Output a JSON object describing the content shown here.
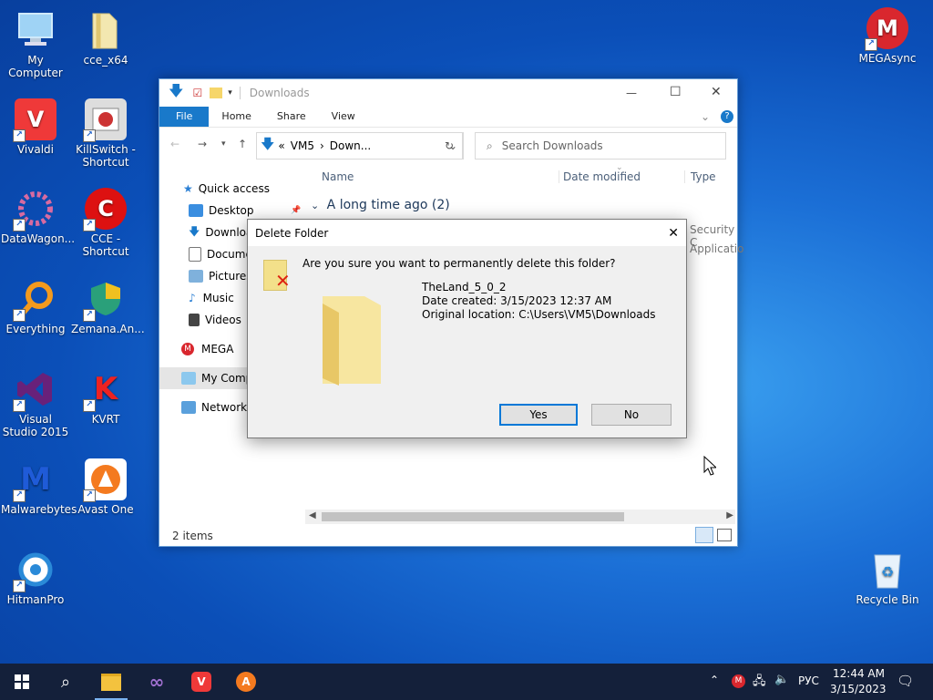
{
  "desktop": {
    "icons_left": [
      {
        "label": "My Computer",
        "icon": "computer-icon"
      },
      {
        "label": "cce_x64",
        "icon": "folder-icon"
      },
      {
        "label": "Vivaldi",
        "icon": "vivaldi-icon"
      },
      {
        "label": "KillSwitch - Shortcut",
        "icon": "killswitch-icon"
      },
      {
        "label": "DataWagon...",
        "icon": "datawagon-icon"
      },
      {
        "label": "CCE - Shortcut",
        "icon": "cce-icon"
      },
      {
        "label": "Everything",
        "icon": "everything-icon"
      },
      {
        "label": "Zemana.An...",
        "icon": "zemana-icon"
      },
      {
        "label": "Visual Studio 2015",
        "icon": "visual-studio-icon"
      },
      {
        "label": "KVRT",
        "icon": "kvrt-icon"
      },
      {
        "label": "Malwarebytes",
        "icon": "malwarebytes-icon"
      },
      {
        "label": "Avast One",
        "icon": "avast-icon"
      },
      {
        "label": "HitmanPro",
        "icon": "hitmanpro-icon"
      }
    ],
    "icons_right": [
      {
        "label": "MEGAsync",
        "icon": "mega-icon"
      },
      {
        "label": "Recycle Bin",
        "icon": "recycle-bin-icon"
      }
    ]
  },
  "explorer": {
    "title": "Downloads",
    "ribbon_tabs": [
      "File",
      "Home",
      "Share",
      "View"
    ],
    "address": {
      "prefix": "«",
      "part1": "VM5",
      "sep": "›",
      "part2": "Down..."
    },
    "search_placeholder": "Search Downloads",
    "nav": [
      {
        "label": "Quick access",
        "icon": "star-icon"
      },
      {
        "label": "Desktop",
        "icon": "desktop-icon"
      },
      {
        "label": "Downloads",
        "icon": "download-arrow-icon"
      },
      {
        "label": "Documents",
        "icon": "document-icon"
      },
      {
        "label": "Pictures",
        "icon": "pictures-icon"
      },
      {
        "label": "Music",
        "icon": "music-icon"
      },
      {
        "label": "Videos",
        "icon": "videos-icon"
      },
      {
        "label": "MEGA",
        "icon": "mega-icon"
      },
      {
        "label": "My Computer",
        "icon": "computer-icon"
      },
      {
        "label": "Network",
        "icon": "network-icon"
      }
    ],
    "columns": {
      "name": "Name",
      "date": "Date modified",
      "type": "Type"
    },
    "group_label": "A long time ago (2)",
    "type_values": [
      "Security C",
      "Applicatio"
    ],
    "status": "2 items"
  },
  "dialog": {
    "title": "Delete Folder",
    "question": "Are you sure you want to permanently delete this folder?",
    "item_name": "TheLand_5_0_2",
    "date_created": "Date created: 3/15/2023 12:37 AM",
    "original_location": "Original location: C:\\Users\\VM5\\Downloads",
    "yes": "Yes",
    "no": "No"
  },
  "taskbar": {
    "language": "РУС",
    "time": "12:44 AM",
    "date": "3/15/2023"
  },
  "colors": {
    "accent": "#1979ca",
    "taskbar": "#14203a"
  }
}
